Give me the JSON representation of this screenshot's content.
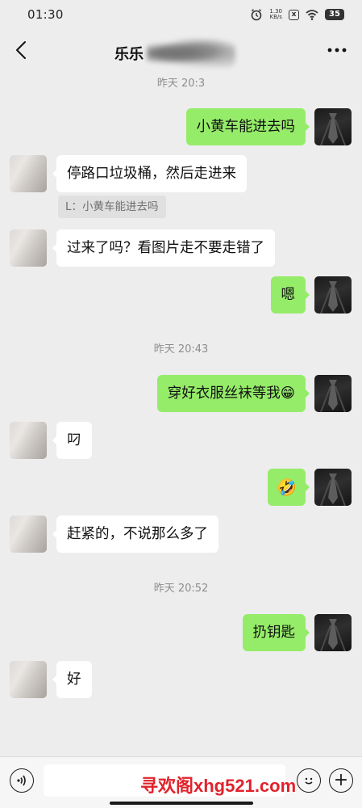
{
  "status_bar": {
    "time": "01:30",
    "net_speed_value": "1.30",
    "net_speed_unit": "KB/s",
    "x_badge": "x",
    "battery": "35",
    "icons": [
      "alarm-icon",
      "x-badge-icon",
      "wifi-icon",
      "battery-icon"
    ]
  },
  "header": {
    "title": "乐乐",
    "back_icon": "chevron-left-icon",
    "more_label": "···"
  },
  "timestamps": {
    "t0": "昨天 20:3",
    "t1": "昨天 20:43",
    "t2": "昨天 20:52"
  },
  "messages": [
    {
      "side": "out",
      "text": "小黄车能进去吗"
    },
    {
      "side": "in",
      "text": "停路口垃圾桶，然后走进来",
      "quote": "L：小黄车能进去吗"
    },
    {
      "side": "in",
      "text": "过来了吗？看图片走不要走错了"
    },
    {
      "side": "out",
      "text": "嗯"
    },
    {
      "side": "out",
      "text": "穿好衣服丝袜等我😁"
    },
    {
      "side": "in",
      "text": "叼"
    },
    {
      "side": "out",
      "text": "🤣"
    },
    {
      "side": "in",
      "text": "赶紧的，不说那么多了"
    },
    {
      "side": "out",
      "text": "扔钥匙"
    },
    {
      "side": "in",
      "text": "好"
    }
  ],
  "input_bar": {
    "placeholder": "",
    "voice_icon": "voice-icon",
    "emoji_icon": "emoji-icon",
    "plus_label": "+"
  },
  "watermark": "寻欢阁xhg521.com",
  "colors": {
    "background": "#EDEDED",
    "outgoing_bubble": "#95EC69",
    "incoming_bubble": "#FFFFFF",
    "watermark": "#E1222B"
  }
}
